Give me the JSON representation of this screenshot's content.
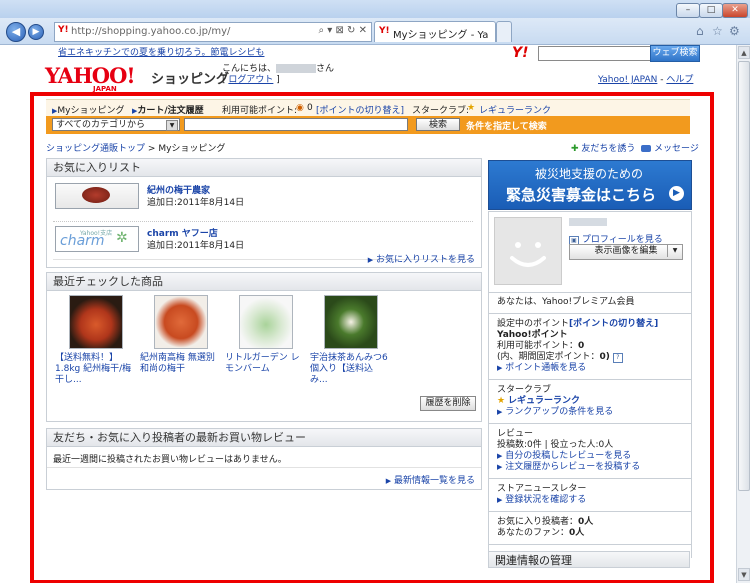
{
  "browser": {
    "url": "http://shopping.yahoo.co.jp/my/",
    "tab_title": "Myショッピング - Yahoo...",
    "address_icons": "⌕ ▾ ⊠ ↻ ✕"
  },
  "header": {
    "promo_link": "省エネキッチンでの夏を乗り切ろう。節電レシピも",
    "search_btn": "ウェブ検索",
    "logo_text": "YAHOO!",
    "logo_sub": "JAPAN",
    "service_name": "ショッピング",
    "greeting_prefix": "こんにちは、",
    "greeting_suffix": "さん",
    "logout": "ログアウト",
    "yahoo_japan": "Yahoo! JAPAN",
    "help": "ヘルプ",
    "sep": "-"
  },
  "subnav": {
    "myshopping": "Myショッピング",
    "cart": "カート/注文履歴",
    "points_label": "利用可能ポイント:",
    "points_value": "0",
    "points_switch": "[ポイントの切り替え]",
    "starclub_label": "スタークラブ:",
    "starclub_rank": "レギュラーランク"
  },
  "searchbar": {
    "category": "すべてのカテゴリから",
    "button": "検索",
    "condition": "条件を指定して検索"
  },
  "breadcrumb": {
    "top": "ショッピング通販トップ",
    "sep": ">",
    "current": "Myショッピング"
  },
  "invite": {
    "friends": "友だちを誘う",
    "message": "メッセージ"
  },
  "favorites": {
    "title": "お気に入りリスト",
    "items": [
      {
        "name": "紀州の梅干農家",
        "date": "追加日:2011年8月14日"
      },
      {
        "name": "charm ヤフー店",
        "date": "追加日:2011年8月14日"
      }
    ],
    "logo_charm": "charm",
    "logo_charm_sub": "Yahoo!支店",
    "more": "お気に入りリストを見る"
  },
  "recent": {
    "title": "最近チェックした商品",
    "items": [
      {
        "text": "【送料無料！】1.8kg 紀州梅干/梅干し..."
      },
      {
        "text": "紀州南高梅 無選別 和尚の梅干"
      },
      {
        "text": "リトルガーデン レモンバーム"
      },
      {
        "text": "宇治抹茶あんみつ6個入り【送料込み..."
      }
    ],
    "delete": "履歴を削除"
  },
  "reviews": {
    "title": "友だち・お気に入り投稿者の最新お買い物レビュー",
    "empty": "最近一週間に投稿されたお買い物レビューはありません。",
    "more": "最新情報一覧を見る"
  },
  "banner": {
    "line1": "被災地支援のための",
    "line2": "緊急災害募金はこちら"
  },
  "profile": {
    "view": "プロフィールを見る",
    "edit": "表示画像を編集",
    "premium": "あなたは、Yahoo!プレミアム会員"
  },
  "points": {
    "setting_label": "設定中のポイント",
    "switch": "[ポイントの切り替え]",
    "yahoo_point": "Yahoo!ポイント",
    "available": "利用可能ポイント：",
    "available_value": "0",
    "fixed": "(内、期間固定ポイント：",
    "fixed_value": "0)",
    "history": "ポイント通帳を見る"
  },
  "starclub": {
    "title": "スタークラブ",
    "rank": "レギュラーランク",
    "condition": "ランクアップの条件を見る"
  },
  "review_stats": {
    "title": "レビュー",
    "counts": "投稿数:0件 | 役立った人:0人",
    "my_reviews": "自分の投稿したレビューを見る",
    "post": "注文履歴からレビューを投稿する"
  },
  "newsletter": {
    "title": "ストアニュースレター",
    "status": "登録状況を確認する"
  },
  "fav_poster": {
    "label": "お気に入り投稿者：",
    "value": "0人",
    "fans_label": "あなたのファン：",
    "fans_value": "0人"
  },
  "related": {
    "title": "関連情報の管理"
  }
}
